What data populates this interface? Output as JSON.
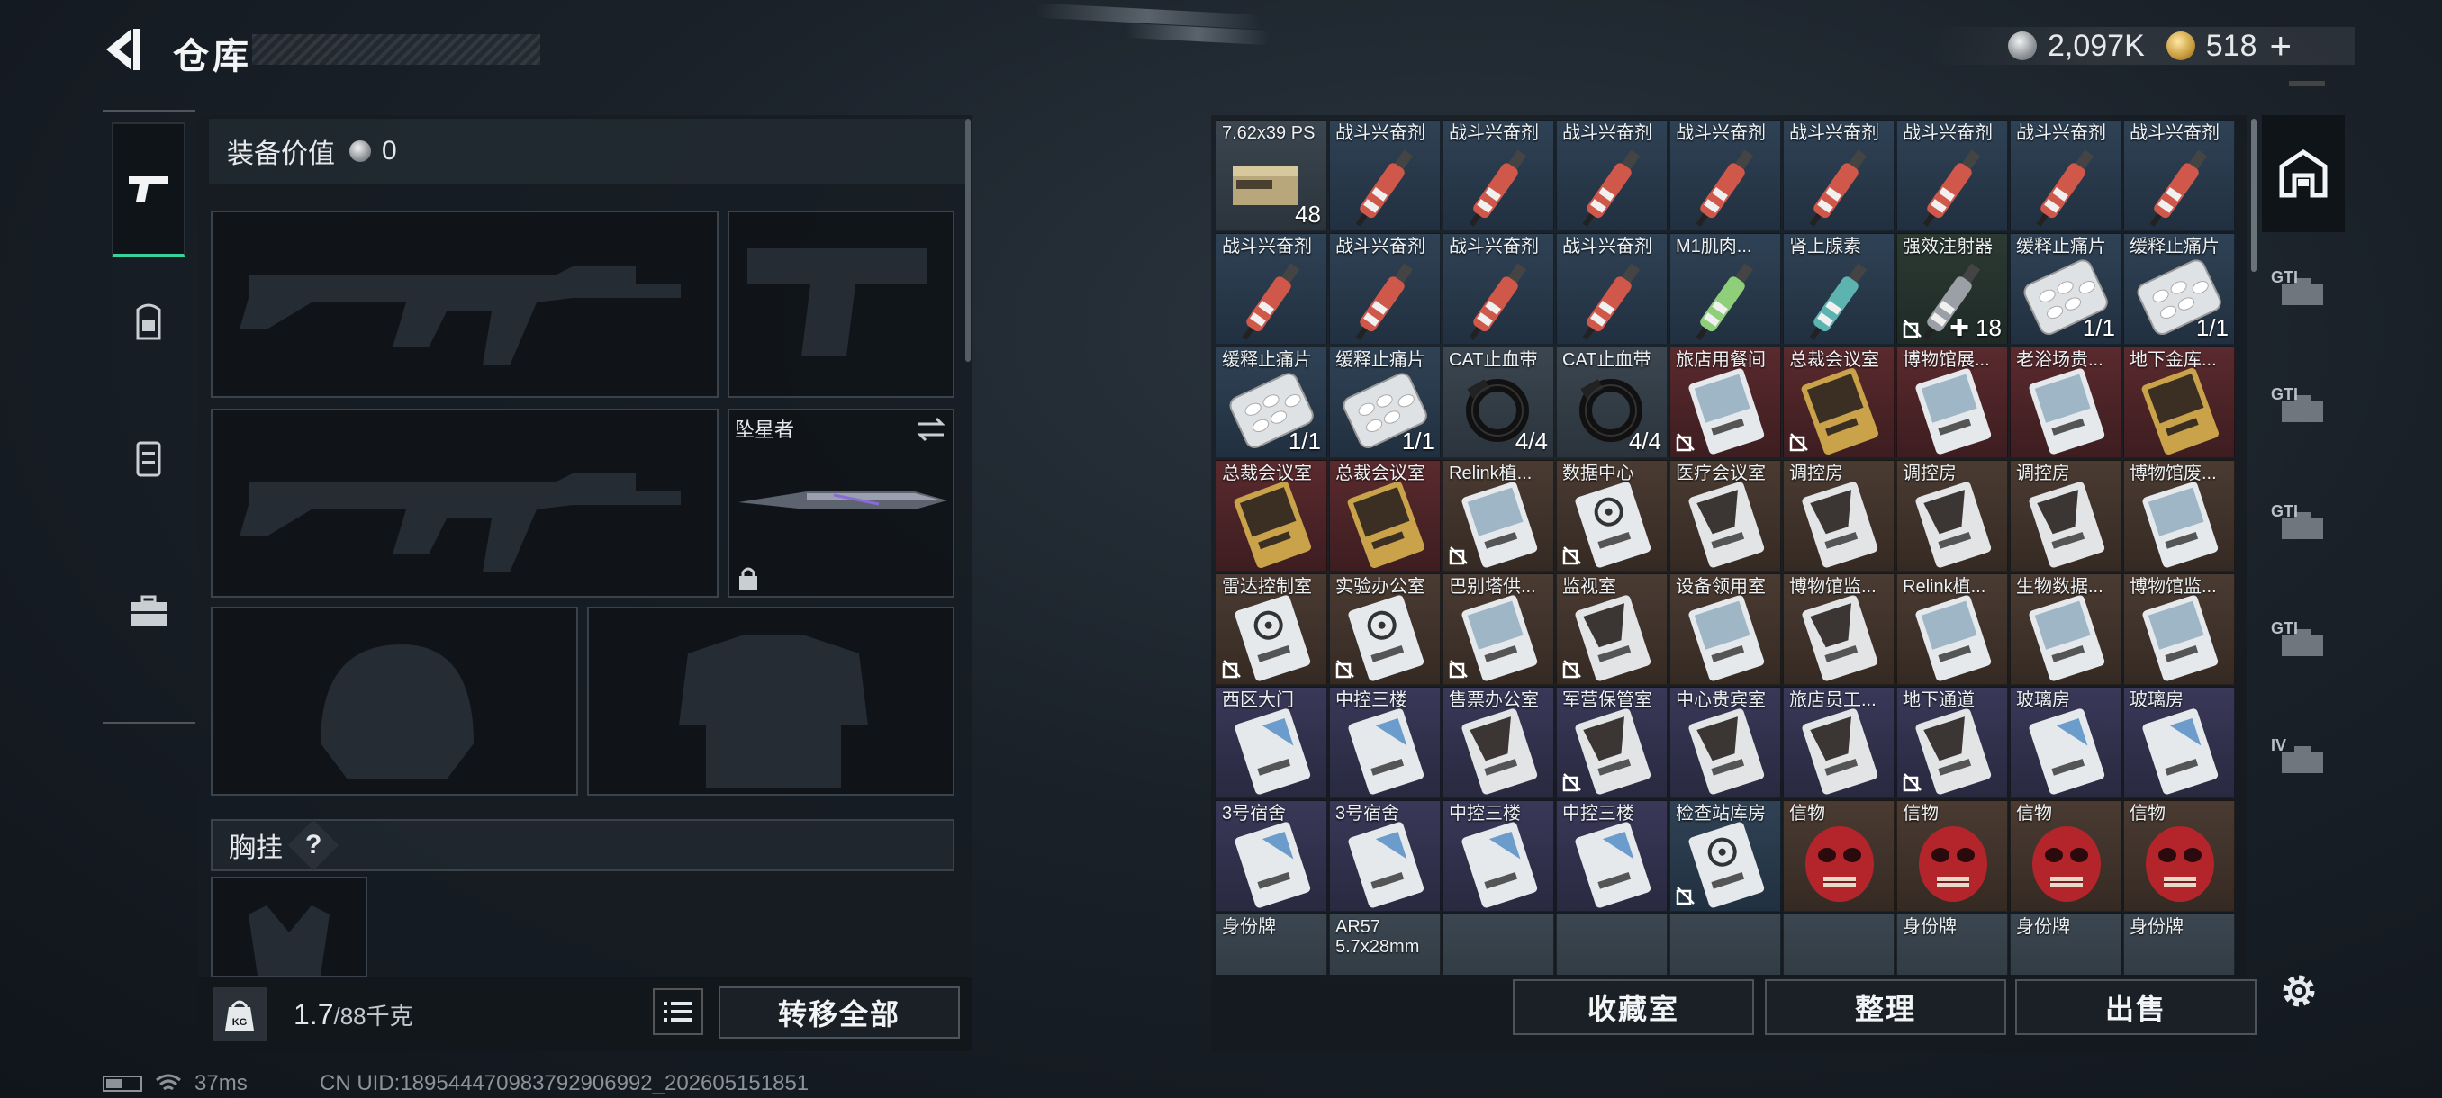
{
  "header": {
    "title": "仓库",
    "currency_silver": "2,097K",
    "currency_gold": "518",
    "currency_plus": "+"
  },
  "left_nav": [
    "weapon-tab",
    "backpack-tab",
    "vest-tab",
    "case-tab"
  ],
  "equipment": {
    "value_label": "装备价值",
    "value": "0",
    "melee_name": "坠星者",
    "chest_label": "胸挂",
    "chest_help": "?"
  },
  "bottom_left": {
    "weight": "1.7",
    "weight_cap": "/88千克",
    "transfer_all": "转移全部",
    "weight_icon": "KG"
  },
  "status": {
    "ping": "37ms",
    "uid": "CN UID:18954447098379290699​2_202605151851"
  },
  "bottom_right": {
    "collection": "收藏室",
    "sort": "整理",
    "sell": "出售"
  },
  "right_nav": [
    {
      "label": ""
    },
    {
      "label": "GTI"
    },
    {
      "label": "GTI"
    },
    {
      "label": "GTI"
    },
    {
      "label": "GTI"
    },
    {
      "label": "IV"
    }
  ],
  "grid": [
    [
      {
        "n": "7.62x39 PS",
        "c": "48",
        "t": "gray",
        "a": "ammo"
      },
      {
        "n": "战斗兴奋剂",
        "t": "blue",
        "a": "syringe-red"
      },
      {
        "n": "战斗兴奋剂",
        "t": "blue",
        "a": "syringe-red"
      },
      {
        "n": "战斗兴奋剂",
        "t": "blue",
        "a": "syringe-red"
      },
      {
        "n": "战斗兴奋剂",
        "t": "blue",
        "a": "syringe-red"
      },
      {
        "n": "战斗兴奋剂",
        "t": "blue",
        "a": "syringe-red"
      },
      {
        "n": "战斗兴奋剂",
        "t": "blue",
        "a": "syringe-red"
      },
      {
        "n": "战斗兴奋剂",
        "t": "blue",
        "a": "syringe-red"
      },
      {
        "n": "战斗兴奋剂",
        "t": "blue",
        "a": "syringe-red"
      }
    ],
    [
      {
        "n": "战斗兴奋剂",
        "t": "blue",
        "a": "syringe-red"
      },
      {
        "n": "战斗兴奋剂",
        "t": "blue",
        "a": "syringe-red"
      },
      {
        "n": "战斗兴奋剂",
        "t": "blue",
        "a": "syringe-red"
      },
      {
        "n": "战斗兴奋剂",
        "t": "blue",
        "a": "syringe-red"
      },
      {
        "n": "M1肌肉...",
        "t": "blue",
        "a": "syringe-green"
      },
      {
        "n": "肾上腺素",
        "t": "blue",
        "a": "syringe-teal"
      },
      {
        "n": "强效注射器",
        "c": "✚ 18",
        "t": "green",
        "a": "syringe-gray",
        "m": true
      },
      {
        "n": "缓释止痛片",
        "c": "1/1",
        "t": "blue",
        "a": "pills"
      },
      {
        "n": "缓释止痛片",
        "c": "1/1",
        "t": "blue",
        "a": "pills"
      }
    ],
    [
      {
        "n": "缓释止痛片",
        "c": "1/1",
        "t": "blue",
        "a": "pills"
      },
      {
        "n": "缓释止痛片",
        "c": "1/1",
        "t": "blue",
        "a": "pills"
      },
      {
        "n": "CAT止血带",
        "c": "4/4",
        "t": "gray",
        "a": "tourniquet"
      },
      {
        "n": "CAT止血带",
        "c": "4/4",
        "t": "gray",
        "a": "tourniquet"
      },
      {
        "n": "旅店用餐间",
        "t": "red",
        "a": "card-white",
        "m": true
      },
      {
        "n": "总裁会议室",
        "t": "red",
        "a": "card-gold",
        "m": true
      },
      {
        "n": "博物馆展...",
        "t": "red",
        "a": "card-white"
      },
      {
        "n": "老浴场贵...",
        "t": "red",
        "a": "card-white"
      },
      {
        "n": "地下金库...",
        "t": "red",
        "a": "card-gold"
      }
    ],
    [
      {
        "n": "总裁会议室",
        "t": "red",
        "a": "card-gold"
      },
      {
        "n": "总裁会议室",
        "t": "red",
        "a": "card-gold"
      },
      {
        "n": "Relink植...",
        "t": "orange",
        "a": "card-white",
        "m": true
      },
      {
        "n": "数据中心",
        "t": "orange",
        "a": "card-bio",
        "m": true
      },
      {
        "n": "医疗会议室",
        "t": "orange",
        "a": "card-dark"
      },
      {
        "n": "调控房",
        "t": "orange",
        "a": "card-dark"
      },
      {
        "n": "调控房",
        "t": "orange",
        "a": "card-dark"
      },
      {
        "n": "调控房",
        "t": "orange",
        "a": "card-dark"
      },
      {
        "n": "博物馆废...",
        "t": "orange",
        "a": "card-white"
      }
    ],
    [
      {
        "n": "雷达控制室",
        "t": "orange",
        "a": "card-bio",
        "m": true
      },
      {
        "n": "实验办公室",
        "t": "orange",
        "a": "card-bio",
        "m": true
      },
      {
        "n": "巴别塔供...",
        "t": "orange",
        "a": "card-white",
        "m": true
      },
      {
        "n": "监视室",
        "t": "orange",
        "a": "card-dark",
        "m": true
      },
      {
        "n": "设备领用室",
        "t": "orange",
        "a": "card-white"
      },
      {
        "n": "博物馆监...",
        "t": "orange",
        "a": "card-dark"
      },
      {
        "n": "Relink植...",
        "t": "orange",
        "a": "card-white"
      },
      {
        "n": "生物数据...",
        "t": "orange",
        "a": "card-white"
      },
      {
        "n": "博物馆监...",
        "t": "orange",
        "a": "card-white"
      }
    ],
    [
      {
        "n": "西区大门",
        "t": "purple",
        "a": "card-blue"
      },
      {
        "n": "中控三楼",
        "t": "purple",
        "a": "card-blue"
      },
      {
        "n": "售票办公室",
        "t": "purple",
        "a": "card-dark"
      },
      {
        "n": "军营保管室",
        "t": "purple",
        "a": "card-dark",
        "m": true
      },
      {
        "n": "中心贵宾室",
        "t": "purple",
        "a": "card-dark"
      },
      {
        "n": "旅店员工...",
        "t": "purple",
        "a": "card-dark"
      },
      {
        "n": "地下通道",
        "t": "purple",
        "a": "card-dark",
        "m": true
      },
      {
        "n": "玻璃房",
        "t": "purple",
        "a": "card-blue"
      },
      {
        "n": "玻璃房",
        "t": "purple",
        "a": "card-blue"
      }
    ],
    [
      {
        "n": "3号宿舍",
        "t": "purple",
        "a": "card-blue"
      },
      {
        "n": "3号宿舍",
        "t": "purple",
        "a": "card-blue"
      },
      {
        "n": "中控三楼",
        "t": "purple",
        "a": "card-blue"
      },
      {
        "n": "中控三楼",
        "t": "purple",
        "a": "card-blue"
      },
      {
        "n": "检查站库房",
        "t": "blue",
        "a": "card-bio",
        "m": true
      },
      {
        "n": "信物",
        "t": "orange",
        "a": "mask"
      },
      {
        "n": "信物",
        "t": "orange",
        "a": "mask"
      },
      {
        "n": "信物",
        "t": "orange",
        "a": "mask"
      },
      {
        "n": "信物",
        "t": "orange",
        "a": "mask"
      }
    ],
    [
      {
        "n": "身份牌",
        "t": "gray",
        "a": "tag"
      },
      {
        "n": "AR57 5.7x28mm",
        "t": "gray",
        "a": "ammo2"
      },
      {
        "n": "",
        "t": "gray",
        "a": "none"
      },
      {
        "n": "",
        "t": "gray",
        "a": "none"
      },
      {
        "n": "",
        "t": "gray",
        "a": "none"
      },
      {
        "n": "",
        "t": "gray",
        "a": "none"
      },
      {
        "n": "身份牌",
        "t": "gray",
        "a": "tag"
      },
      {
        "n": "身份牌",
        "t": "gray",
        "a": "tag"
      },
      {
        "n": "身份牌",
        "t": "gray",
        "a": "tag"
      }
    ]
  ]
}
